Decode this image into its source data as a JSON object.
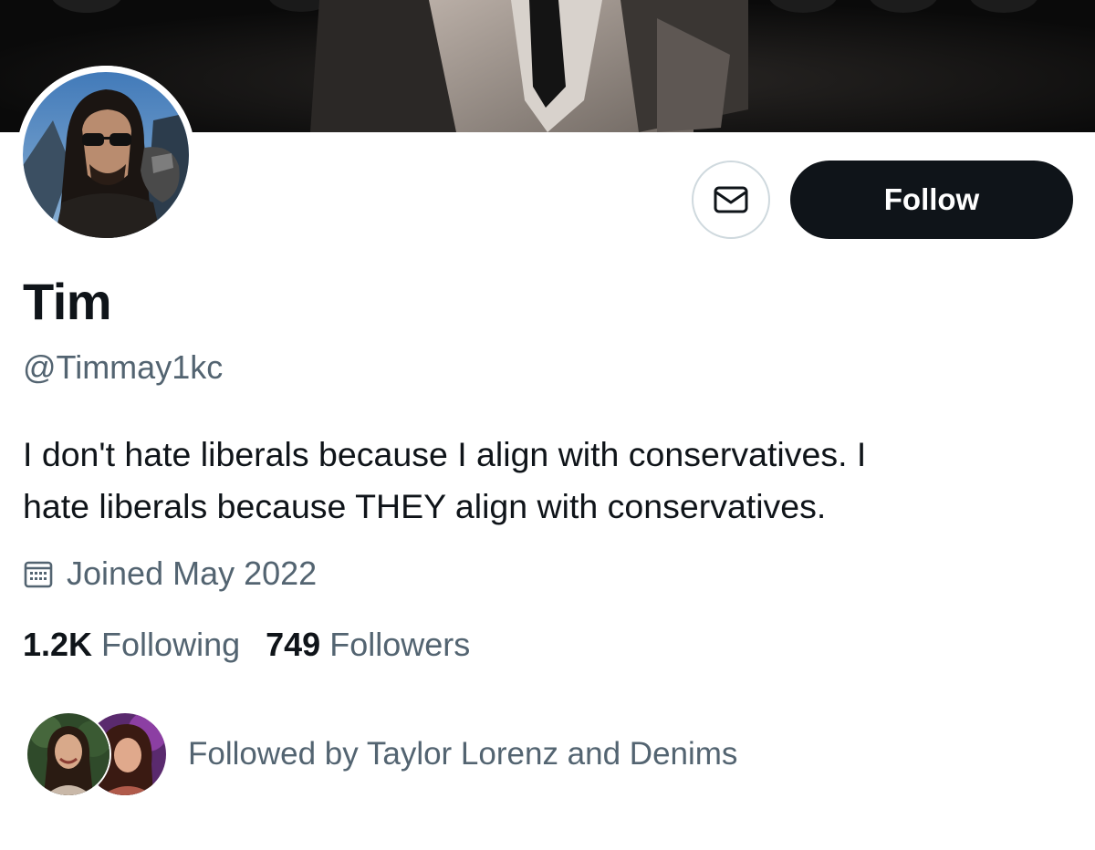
{
  "profile": {
    "display_name": "Tim",
    "handle": "@Timmay1kc",
    "bio_lines": [
      "I don't hate liberals because I align with conservatives. I",
      "hate liberals because THEY align with conservatives."
    ],
    "joined": "Joined May 2022",
    "joined_icon": "calendar-icon"
  },
  "actions": {
    "message_icon": "envelope-icon",
    "follow_label": "Follow"
  },
  "stats": {
    "following_count": "1.2K",
    "following_label": "Following",
    "followers_count": "749",
    "followers_label": "Followers"
  },
  "followed_by": {
    "text": "Followed by Taylor Lorenz and Denims"
  },
  "colors": {
    "text_primary": "#0f1419",
    "text_secondary": "#536471",
    "follow_button_bg": "#0f1419",
    "follow_button_text": "#ffffff",
    "outline": "#cfd9de",
    "banner_bg": "#0c0c0c"
  }
}
